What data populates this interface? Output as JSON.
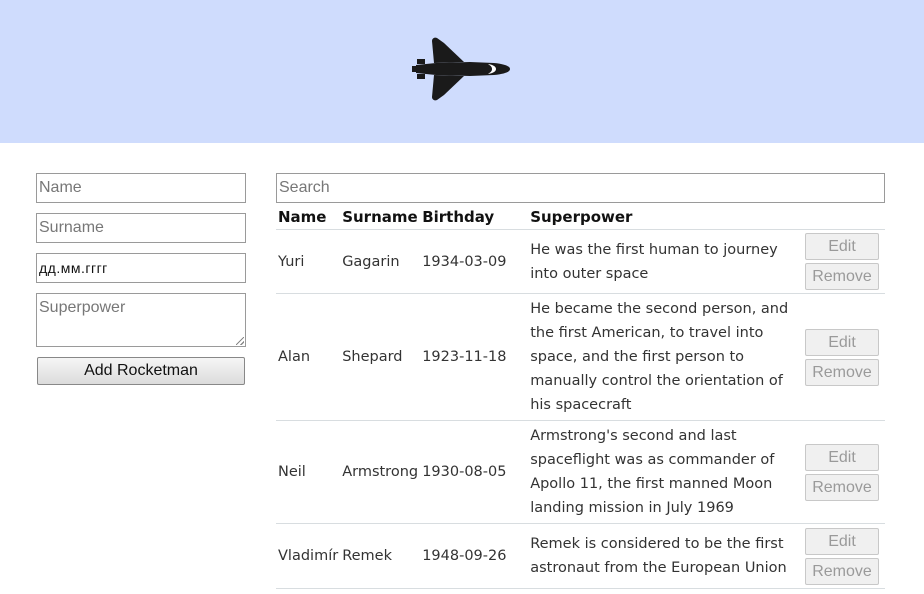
{
  "header": {
    "logo_icon": "space-shuttle-icon",
    "background": "#cfdcfd"
  },
  "form": {
    "name_placeholder": "Name",
    "surname_placeholder": "Surname",
    "birthday_placeholder": "дд.мм.гггг",
    "superpower_placeholder": "Superpower",
    "add_label": "Add Rocketman"
  },
  "search": {
    "placeholder": "Search"
  },
  "table": {
    "columns": [
      "Name",
      "Surname",
      "Birthday",
      "Superpower"
    ],
    "rows": [
      {
        "name": "Yuri",
        "surname": "Gagarin",
        "birthday": "1934-03-09",
        "superpower": "He was the first human to journey into outer space"
      },
      {
        "name": "Alan",
        "surname": "Shepard",
        "birthday": "1923-11-18",
        "superpower": "He became the second person, and the first American, to travel into space, and the first person to manually control the orientation of his spacecraft"
      },
      {
        "name": "Neil",
        "surname": "Armstrong",
        "birthday": "1930-08-05",
        "superpower": "Armstrong's second and last spaceflight was as commander of Apollo 11, the first manned Moon landing mission in July 1969"
      },
      {
        "name": "Vladimír",
        "surname": "Remek",
        "birthday": "1948-09-26",
        "superpower": "Remek is considered to be the first astronaut from the European Union"
      }
    ],
    "edit_label": "Edit",
    "remove_label": "Remove"
  }
}
